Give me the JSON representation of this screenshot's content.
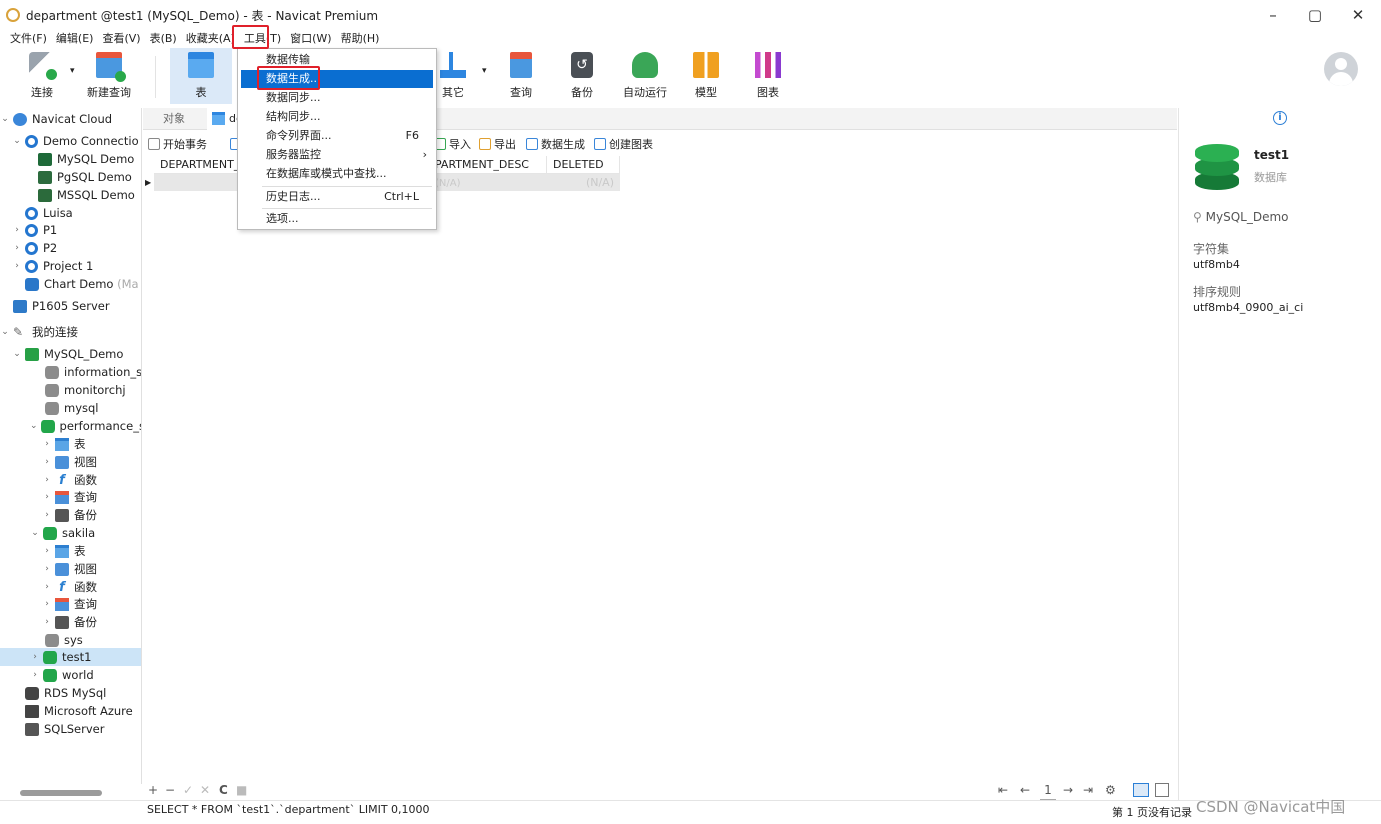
{
  "window": {
    "title": "department @test1 (MySQL_Demo) - 表 - Navicat Premium",
    "controls": [
      "–",
      "▢",
      "✕"
    ]
  },
  "menubar": [
    "文件(F)",
    "编辑(E)",
    "查看(V)",
    "表(B)",
    "收藏夹(A)",
    "工具(T)",
    "窗口(W)",
    "帮助(H)"
  ],
  "toolbar": {
    "connect": "连接",
    "new_query": "新建查询",
    "table": "表",
    "other": "其它",
    "query": "查询",
    "backup": "备份",
    "automation": "自动运行",
    "model": "模型",
    "chart": "图表"
  },
  "tools_menu": {
    "items": [
      "数据传输",
      "数据生成...",
      "数据同步...",
      "结构同步...",
      "命令列界面...",
      "服务器监控",
      "在数据库或模式中查找...",
      "历史日志...",
      "选项..."
    ],
    "shortcuts": {
      "command_line": "F6",
      "history": "Ctrl+L"
    }
  },
  "tree": [
    "Navicat Cloud",
    "Demo Connectio",
    "MySQL Demo",
    "PgSQL Demo",
    "MSSQL Demo",
    "Luisa",
    "P1",
    "P2",
    "Project 1",
    "Chart Demo",
    "(Ma",
    "P1605 Server",
    "我的连接",
    "MySQL_Demo",
    "information_sc",
    "monitorchj",
    "mysql",
    "performance_s",
    "表",
    "视图",
    "函数",
    "查询",
    "备份",
    "sakila",
    "表",
    "视图",
    "函数",
    "查询",
    "备份",
    "sys",
    "test1",
    "world",
    "RDS MySql",
    "Microsoft Azure",
    "SQLServer"
  ],
  "tabs": {
    "objects": "对象",
    "active": "de"
  },
  "object_toolbar": {
    "begin_tx": "开始事务",
    "import": "导入",
    "export": "导出",
    "data_gen": "数据生成",
    "create_chart": "创建图表"
  },
  "grid": {
    "headers": [
      "DEPARTMENT_",
      "PARTMENT_DESC",
      "DELETED"
    ],
    "cells": [
      "(N/A)",
      "(N/A)"
    ]
  },
  "bottom": {
    "edit_controls": [
      "+",
      "−",
      "✓",
      "✕",
      "C",
      "■"
    ],
    "nav": [
      "⇤",
      "←",
      "1",
      "→",
      "⇥",
      "⚙"
    ],
    "page_number": "1"
  },
  "status": {
    "sql": "SELECT * FROM `test1`.`department` LIMIT 0,1000",
    "page": "第 1 页没有记录"
  },
  "right_panel": {
    "db_name": "test1",
    "db_type": "数据库",
    "connection": "MySQL_Demo",
    "charset_label": "字符集",
    "charset_value": "utf8mb4",
    "collation_label": "排序规则",
    "collation_value": "utf8mb4_0900_ai_ci"
  },
  "watermark": "CSDN @Navicat中国"
}
